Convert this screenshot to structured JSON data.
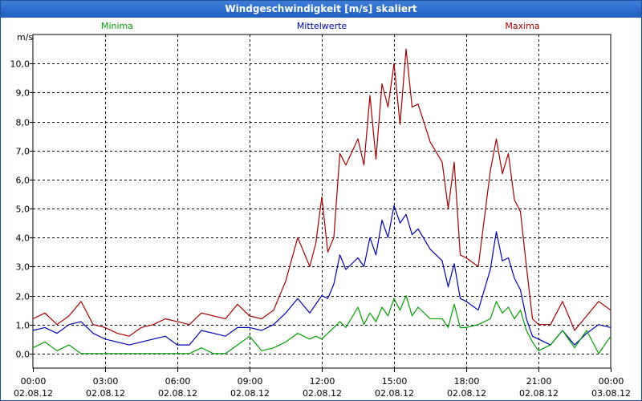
{
  "chart_data": {
    "type": "line",
    "title": "Windgeschwindigkeit [m/s] skaliert",
    "ylabel": "m/s",
    "ylim": [
      -0.5,
      11.0
    ],
    "yticks": [
      0,
      1,
      2,
      3,
      4,
      5,
      6,
      7,
      8,
      9,
      10
    ],
    "ytick_labels": [
      "0,0",
      "1,0",
      "2,0",
      "3,0",
      "4,0",
      "5,0",
      "6,0",
      "7,0",
      "8,0",
      "9,0",
      "10,0"
    ],
    "xlim": [
      0,
      24
    ],
    "xticks": [
      0,
      3,
      6,
      9,
      12,
      15,
      18,
      21,
      24
    ],
    "xtick_labels": [
      {
        "time": "00:00",
        "date": "02.08.12"
      },
      {
        "time": "03:00",
        "date": "02.08.12"
      },
      {
        "time": "06:00",
        "date": "02.08.12"
      },
      {
        "time": "09:00",
        "date": "02.08.12"
      },
      {
        "time": "12:00",
        "date": "02.08.12"
      },
      {
        "time": "15:00",
        "date": "02.08.12"
      },
      {
        "time": "18:00",
        "date": "02.08.12"
      },
      {
        "time": "21:00",
        "date": "02.08.12"
      },
      {
        "time": "00:00",
        "date": "03.08.12"
      }
    ],
    "grid": true,
    "legend": [
      "Minima",
      "Mittelwerte",
      "Maxima"
    ],
    "series": [
      {
        "name": "Maxima",
        "color": "#a00000",
        "x": [
          0,
          0.5,
          1,
          1.5,
          2,
          2.5,
          3,
          3.5,
          4,
          4.5,
          5,
          5.5,
          6,
          6.5,
          7,
          7.5,
          8,
          8.5,
          9,
          9.5,
          10,
          10.5,
          11,
          11.5,
          11.75,
          12,
          12.25,
          12.5,
          12.75,
          13,
          13.5,
          13.75,
          14,
          14.25,
          14.5,
          14.75,
          15,
          15.25,
          15.5,
          15.75,
          16,
          16.5,
          17,
          17.25,
          17.5,
          17.75,
          18,
          18.5,
          19,
          19.25,
          19.5,
          19.75,
          20,
          20.25,
          20.5,
          20.75,
          21,
          21.5,
          22,
          22.5,
          23,
          23.5,
          24
        ],
        "values": [
          1.2,
          1.4,
          1.0,
          1.3,
          1.8,
          1.0,
          0.9,
          0.7,
          0.6,
          0.9,
          1.0,
          1.2,
          1.1,
          1.0,
          1.4,
          1.3,
          1.2,
          1.7,
          1.3,
          1.2,
          1.5,
          2.5,
          4.0,
          3.0,
          3.8,
          5.4,
          3.5,
          4.0,
          6.9,
          6.5,
          7.4,
          6.5,
          8.9,
          6.7,
          9.3,
          8.5,
          10.0,
          7.9,
          10.5,
          8.5,
          8.6,
          7.3,
          6.6,
          5.0,
          6.6,
          3.4,
          3.3,
          3.0,
          6.3,
          7.4,
          6.2,
          6.9,
          5.3,
          4.9,
          3.0,
          1.2,
          1.0,
          1.0,
          1.8,
          0.8,
          1.3,
          1.8,
          1.5
        ]
      },
      {
        "name": "Mittelwerte",
        "color": "#0000b0",
        "x": [
          0,
          0.5,
          1,
          1.5,
          2,
          2.5,
          3,
          3.5,
          4,
          4.5,
          5,
          5.5,
          6,
          6.5,
          7,
          7.5,
          8,
          8.5,
          9,
          9.5,
          10,
          10.5,
          11,
          11.5,
          11.75,
          12,
          12.25,
          12.5,
          12.75,
          13,
          13.5,
          13.75,
          14,
          14.25,
          14.5,
          14.75,
          15,
          15.25,
          15.5,
          15.75,
          16,
          16.5,
          17,
          17.25,
          17.5,
          17.75,
          18,
          18.5,
          19,
          19.25,
          19.5,
          19.75,
          20,
          20.25,
          20.5,
          20.75,
          21,
          21.5,
          22,
          22.5,
          23,
          23.5,
          24
        ],
        "values": [
          0.8,
          0.9,
          0.7,
          1.0,
          1.1,
          0.7,
          0.5,
          0.4,
          0.3,
          0.4,
          0.5,
          0.6,
          0.3,
          0.3,
          0.8,
          0.7,
          0.6,
          0.9,
          0.9,
          0.8,
          1.0,
          1.4,
          1.9,
          1.4,
          1.7,
          2.0,
          1.9,
          2.4,
          3.4,
          2.9,
          3.3,
          3.0,
          4.0,
          3.4,
          4.6,
          4.0,
          5.1,
          4.5,
          4.8,
          4.1,
          4.3,
          3.6,
          3.2,
          2.3,
          3.1,
          1.9,
          1.8,
          1.5,
          2.9,
          4.2,
          3.2,
          3.3,
          2.6,
          2.2,
          1.2,
          0.6,
          0.5,
          0.3,
          0.8,
          0.3,
          0.7,
          1.0,
          0.9
        ]
      },
      {
        "name": "Minima",
        "color": "#00a000",
        "x": [
          0,
          0.5,
          1,
          1.5,
          2,
          2.5,
          3,
          3.5,
          4,
          4.5,
          5,
          5.5,
          6,
          6.5,
          7,
          7.5,
          8,
          8.5,
          9,
          9.5,
          10,
          10.5,
          11,
          11.5,
          11.75,
          12,
          12.25,
          12.5,
          12.75,
          13,
          13.5,
          13.75,
          14,
          14.25,
          14.5,
          14.75,
          15,
          15.25,
          15.5,
          15.75,
          16,
          16.5,
          17,
          17.25,
          17.5,
          17.75,
          18,
          18.5,
          19,
          19.25,
          19.5,
          19.75,
          20,
          20.25,
          20.5,
          20.75,
          21,
          21.5,
          22,
          22.5,
          23,
          23.5,
          24
        ],
        "values": [
          0.2,
          0.4,
          0.1,
          0.3,
          0.0,
          0.0,
          0.0,
          0.0,
          0.0,
          0.0,
          0.0,
          0.0,
          0.0,
          0.0,
          0.2,
          0.0,
          0.0,
          0.3,
          0.6,
          0.1,
          0.2,
          0.4,
          0.7,
          0.5,
          0.6,
          0.5,
          0.7,
          0.9,
          1.1,
          0.9,
          1.6,
          1.0,
          1.4,
          1.1,
          1.6,
          1.3,
          1.9,
          1.5,
          2.0,
          1.3,
          1.6,
          1.2,
          1.2,
          0.9,
          1.7,
          0.9,
          0.9,
          1.0,
          1.2,
          1.8,
          1.4,
          1.6,
          1.2,
          1.5,
          0.8,
          0.4,
          0.1,
          0.3,
          0.8,
          0.2,
          0.8,
          0.0,
          0.6
        ]
      }
    ]
  }
}
